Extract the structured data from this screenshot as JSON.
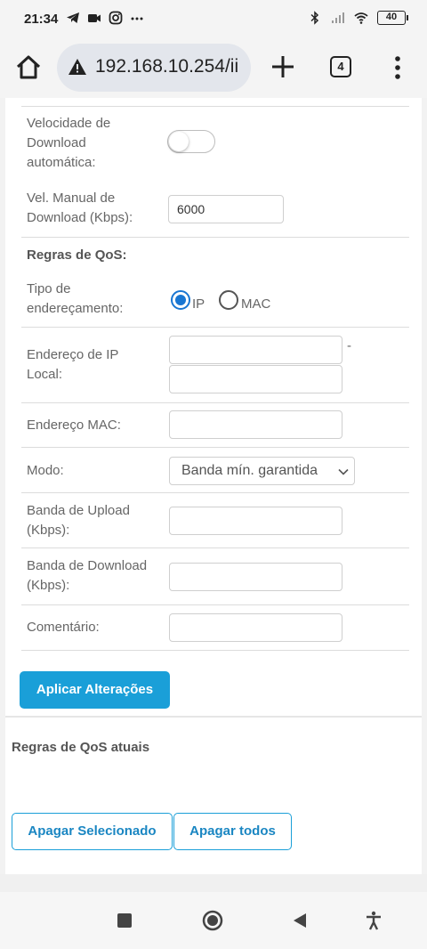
{
  "status_bar": {
    "time": "21:34",
    "left_icons": [
      "telegram-icon",
      "video-camera-icon",
      "instagram-icon",
      "more-dots-icon"
    ],
    "right_icons": [
      "bluetooth-icon",
      "cellular-signal-icon",
      "wifi-icon"
    ],
    "battery": "40"
  },
  "browser": {
    "url": "192.168.10.254/ii",
    "tab_count": "4"
  },
  "form": {
    "auto_download_label": "Velocidade de Download automática:",
    "auto_download_enabled": false,
    "manual_download_label": "Vel. Manual de Download (Kbps):",
    "manual_download_value": "6000",
    "qos_rules_heading": "Regras de QoS:",
    "addressing_type_label": "Tipo de endereçamento:",
    "addressing_options": {
      "ip": "IP",
      "mac": "MAC"
    },
    "addressing_selected": "IP",
    "local_ip_label": "Endereço de IP Local:",
    "range_separator": "-",
    "mac_label": "Endereço MAC:",
    "mode_label": "Modo:",
    "mode_value": "Banda mín. garantida",
    "upload_label": "Banda de Upload (Kbps):",
    "download_label": "Banda de Download (Kbps):",
    "comment_label": "Comentário:",
    "apply_button": "Aplicar Alterações"
  },
  "current_rules": {
    "heading": "Regras de QoS atuais",
    "delete_selected_button": "Apagar Selecionado",
    "delete_all_button": "Apagar todos"
  },
  "colors": {
    "accent": "#1a9fd8",
    "radio_active": "#1976d2"
  }
}
